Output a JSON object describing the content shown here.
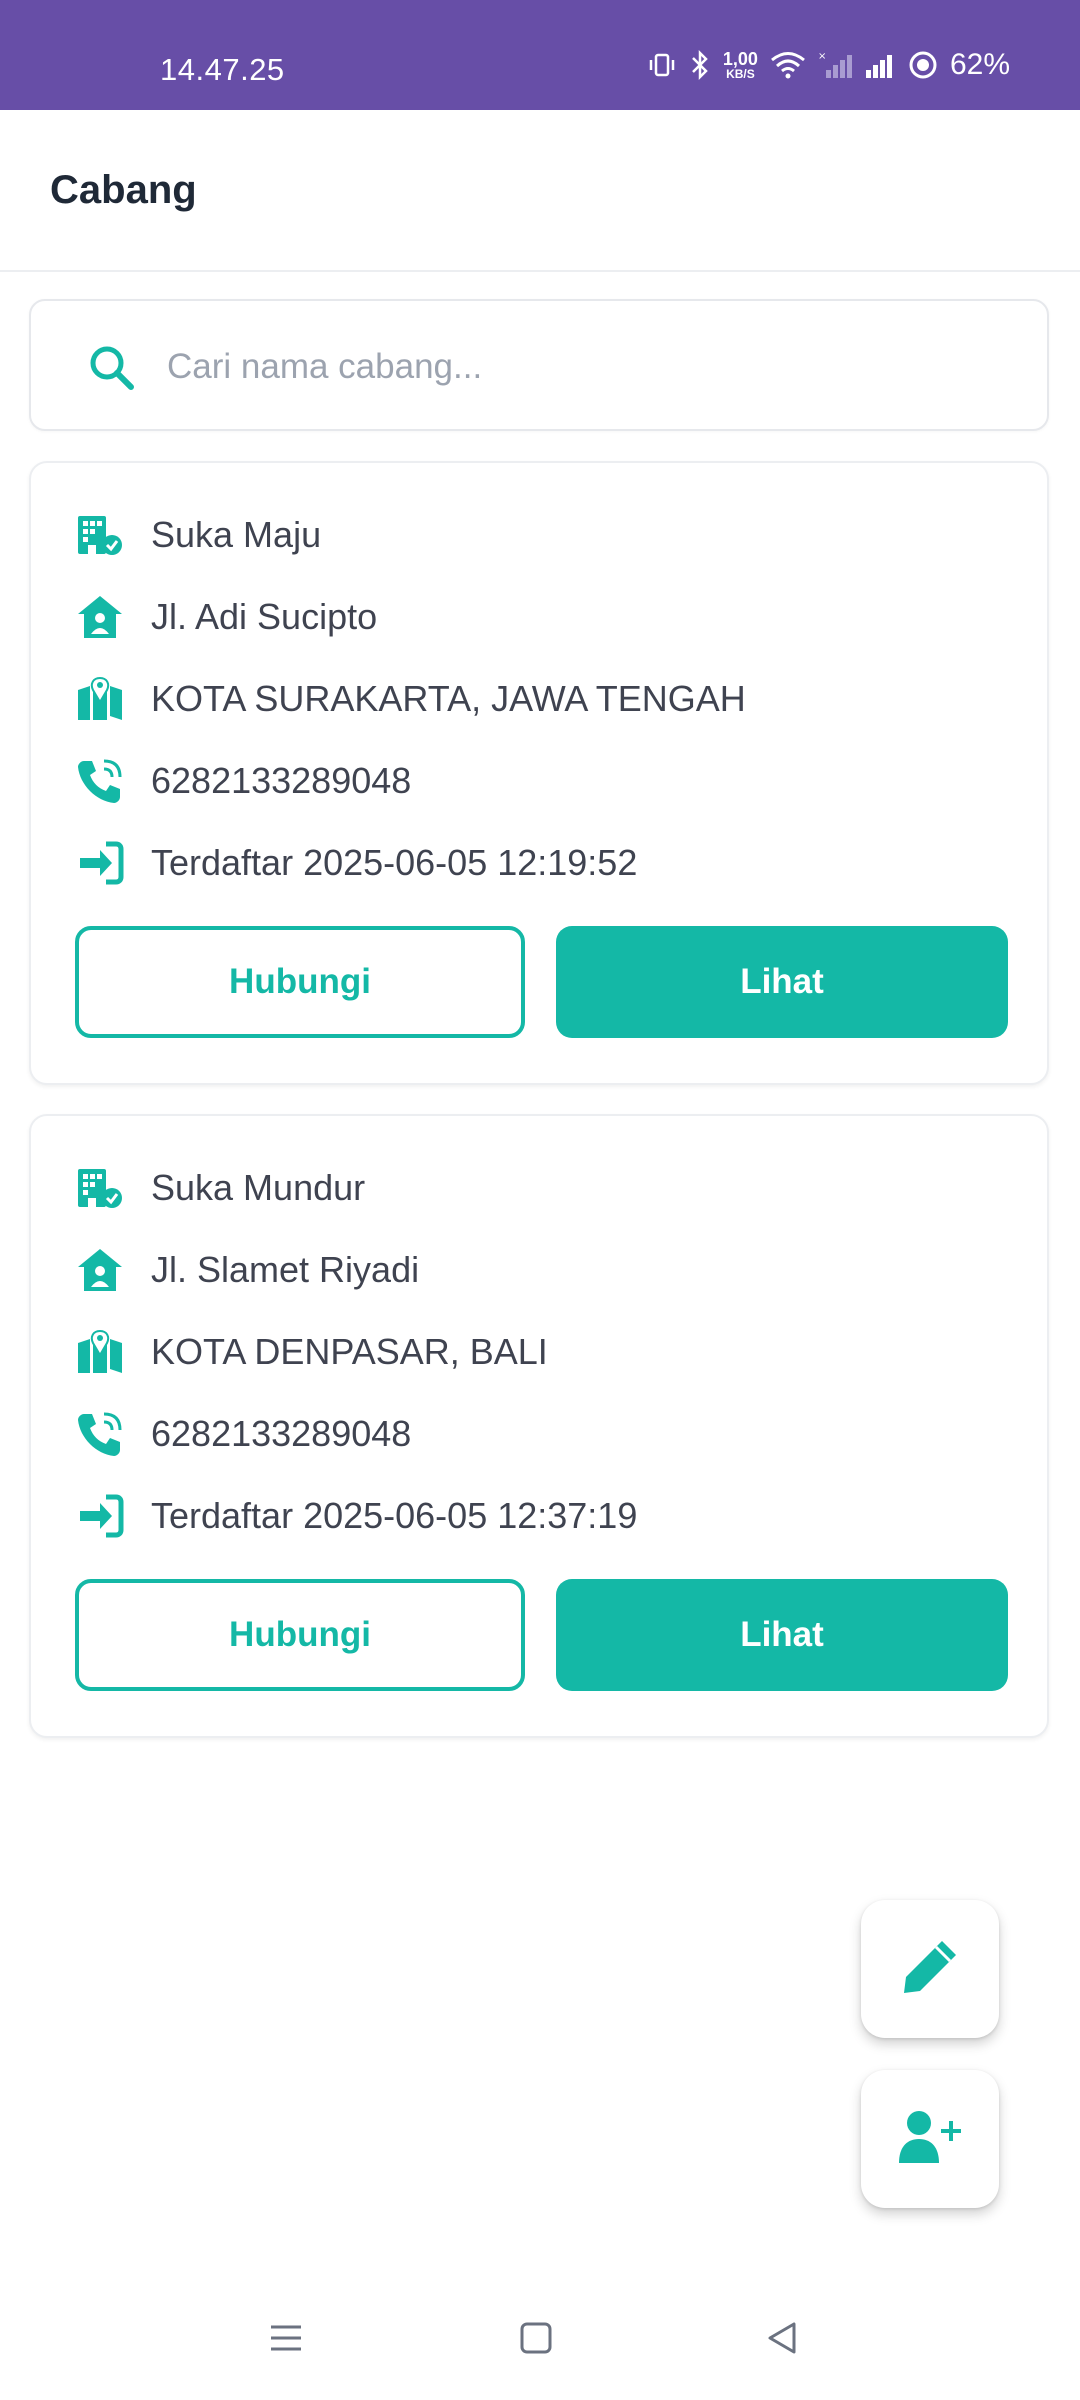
{
  "status_bar": {
    "time": "14.47.25",
    "net_speed_value": "1,00",
    "net_speed_unit": "KB/S",
    "battery": "62%"
  },
  "header": {
    "title": "Cabang"
  },
  "search": {
    "placeholder": "Cari nama cabang...",
    "icon": "search-icon"
  },
  "branches": [
    {
      "name": "Suka Maju",
      "address": "Jl. Adi Sucipto",
      "region": "KOTA SURAKARTA, JAWA TENGAH",
      "phone": "6282133289048",
      "registered": "Terdaftar 2025-06-05 12:19:52",
      "contact_label": "Hubungi",
      "view_label": "Lihat"
    },
    {
      "name": "Suka Mundur",
      "address": "Jl. Slamet Riyadi",
      "region": "KOTA DENPASAR, BALI",
      "phone": "6282133289048",
      "registered": "Terdaftar 2025-06-05 12:37:19",
      "contact_label": "Hubungi",
      "view_label": "Lihat"
    }
  ],
  "fabs": {
    "edit_icon": "pencil-icon",
    "add_user_icon": "user-plus-icon"
  },
  "colors": {
    "accent": "#14b8a6",
    "status_bar": "#674ea7"
  }
}
